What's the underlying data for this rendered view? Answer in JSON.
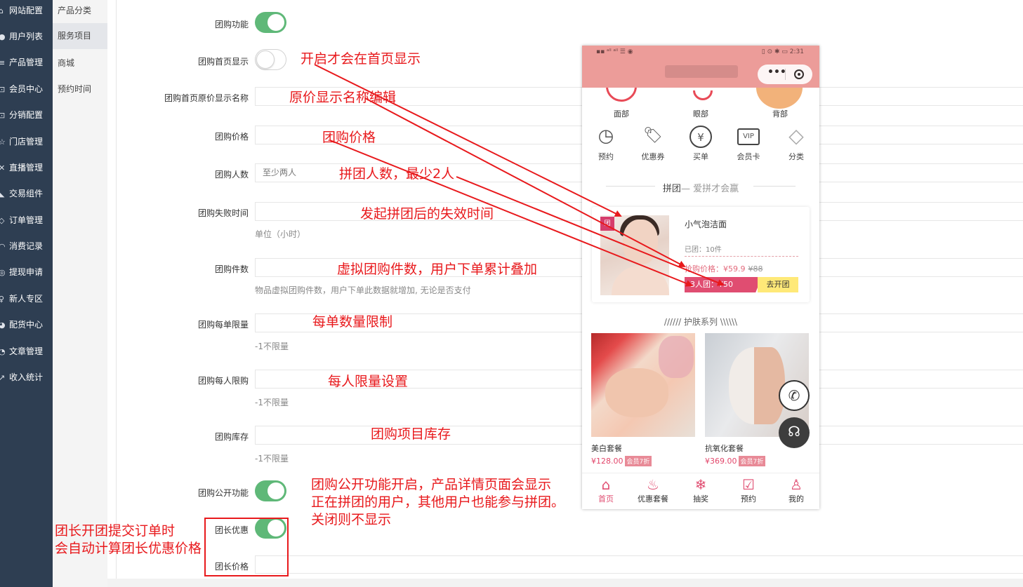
{
  "sidebar": {
    "items": [
      {
        "icon": "home-icon",
        "glyph": "⌂",
        "label": "网站配置"
      },
      {
        "icon": "user-icon",
        "glyph": "●",
        "label": "用户列表"
      },
      {
        "icon": "list-icon",
        "glyph": "≡",
        "label": "产品管理"
      },
      {
        "icon": "cart-icon",
        "glyph": "⊡",
        "label": "会员中心"
      },
      {
        "icon": "share-icon",
        "glyph": "⊡",
        "label": "分销配置"
      },
      {
        "icon": "star-icon",
        "glyph": "☆",
        "label": "门店管理"
      },
      {
        "icon": "broadcast-icon",
        "glyph": "✕",
        "label": "直播管理"
      },
      {
        "icon": "tag-icon",
        "glyph": "◣",
        "label": "交易组件"
      },
      {
        "icon": "order-icon",
        "glyph": "◇",
        "label": "订单管理"
      },
      {
        "icon": "record-icon",
        "glyph": "◠",
        "label": "消费记录"
      },
      {
        "icon": "withdraw-icon",
        "glyph": "◎",
        "label": "提现申请"
      },
      {
        "icon": "gift-icon",
        "glyph": "♀",
        "label": "新人专区"
      },
      {
        "icon": "pie-icon",
        "glyph": "◕",
        "label": "配货中心"
      },
      {
        "icon": "doc-icon",
        "glyph": "◔",
        "label": "文章管理"
      },
      {
        "icon": "chart-icon",
        "glyph": "↗",
        "label": "收入统计"
      }
    ]
  },
  "subnav": {
    "items": [
      "产品分类",
      "服务项目",
      "商城",
      "预约时间"
    ],
    "active_index": 1
  },
  "form": {
    "group_buy_enabled_label": "团购功能",
    "group_buy_enabled": true,
    "homepage_show_label": "团购首页显示",
    "homepage_show": false,
    "original_price_name_label": "团购首页原价显示名称",
    "original_price_name_value": "",
    "price_label": "团购价格",
    "price_value": "",
    "people_label": "团购人数",
    "people_placeholder": "至少两人",
    "fail_time_label": "团购失败时间",
    "fail_time_value": "",
    "fail_time_hint": "单位（小时）",
    "count_label": "团购件数",
    "count_value": "",
    "count_hint": "物品虚拟团购件数，用户下单此数据就增加, 无论是否支付",
    "per_order_label": "团购每单限量",
    "per_order_value": "",
    "per_order_hint": "-1不限量",
    "per_person_label": "团购每人限购",
    "per_person_value": "",
    "per_person_hint": "-1不限量",
    "stock_label": "团购库存",
    "stock_value": "",
    "stock_hint": "-1不限量",
    "public_label": "团购公开功能",
    "public_enabled": true,
    "leader_discount_label": "团长优惠",
    "leader_discount_enabled": true,
    "leader_price_label": "团长价格",
    "leader_price_value": ""
  },
  "annotations": {
    "homepage": "开启才会在首页显示",
    "original_name": "原价显示名称编辑",
    "price": "团购价格",
    "people": "拼团人数，最少2人",
    "fail_time": "发起拼团后的失效时间",
    "count": "虚拟团购件数，用户下单累计叠加",
    "per_order": "每单数量限制",
    "per_person": "每人限量设置",
    "stock": "团购项目库存",
    "public_line1": "团购公开功能开启，产品详情页面会显示",
    "public_line2": "正在拼团的用户，其他用户也能参与拼团。",
    "public_line3": "关闭则不显示",
    "leader_line1": "团长开团提交订单时",
    "leader_line2": "会自动计算团长优惠价格"
  },
  "phone": {
    "status_left": "▪▪ ᵃˡˡ ᵃˡˡ ☰ ◉",
    "status_right": "▯ ⊙ ✱ ▭ 2:31",
    "capsule_dots": "•••",
    "top_categories": [
      "面部",
      "眼部",
      "背部"
    ],
    "icons": [
      {
        "name": "clock-icon",
        "glyph": "◷",
        "label": "预约"
      },
      {
        "name": "coupon-icon",
        "glyph": "🏷",
        "label": "优惠券"
      },
      {
        "name": "yen-icon",
        "glyph": "¥",
        "label": "买单"
      },
      {
        "name": "vip-icon",
        "glyph": "VIP",
        "label": "会员卡"
      },
      {
        "name": "diamond-icon",
        "glyph": "◇",
        "label": "分类"
      }
    ],
    "group_section_title": "拼团",
    "group_section_sub": "— 爱拼才会赢",
    "group_card": {
      "tag": "团",
      "name": "小气泡洁面",
      "sold": "已团：10件",
      "price_label": "抢购价格：¥59.9",
      "old_price": "¥88",
      "group_btn": "3人团：¥50",
      "go_btn": "去开团"
    },
    "skin_section_title": "////// 护肤系列 \\\\\\\\\\\\",
    "products": [
      {
        "name": "美白套餐",
        "price": "¥128.00",
        "badge": "会员7折"
      },
      {
        "name": "抗氧化套餐",
        "price": "¥369.00",
        "badge": "会员7折"
      }
    ],
    "tabs": [
      {
        "icon": "home-icon",
        "glyph": "⌂",
        "label": "首页"
      },
      {
        "icon": "package-icon",
        "glyph": "♨",
        "label": "优惠套餐"
      },
      {
        "icon": "lottery-icon",
        "glyph": "❄",
        "label": "抽奖"
      },
      {
        "icon": "calendar-icon",
        "glyph": "☑",
        "label": "预约"
      },
      {
        "icon": "person-icon",
        "glyph": "♙",
        "label": "我的"
      }
    ]
  },
  "colors": {
    "sidebar_bg": "#2e3e52",
    "switch_on": "#5fb878",
    "annotation_red": "#e8191c",
    "phone_header": "#ec9c99",
    "brand_pink": "#e04d71"
  }
}
